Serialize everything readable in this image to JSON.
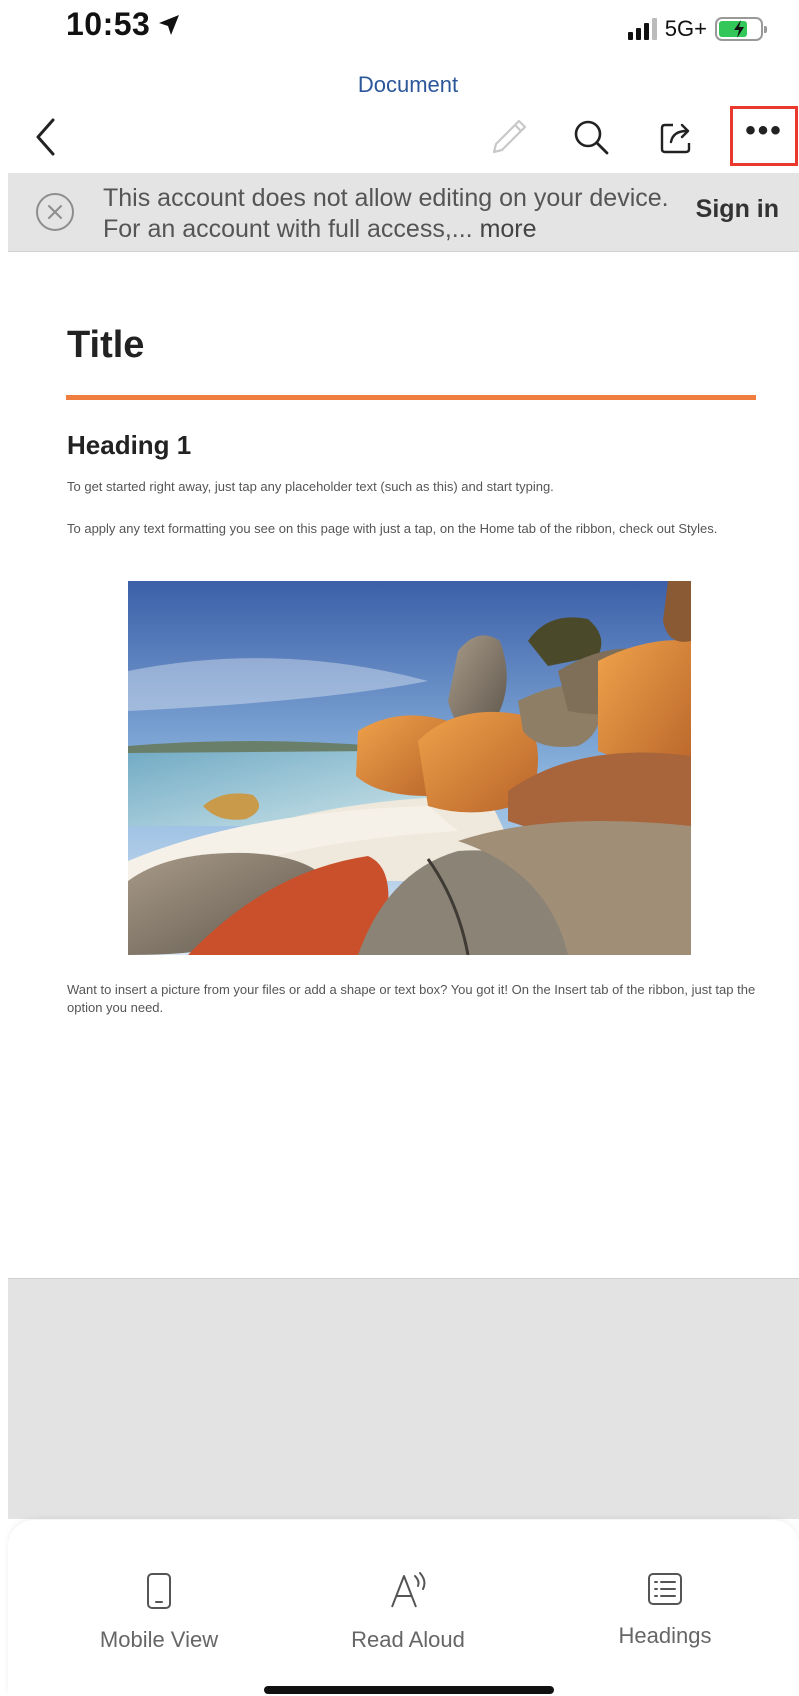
{
  "status_bar": {
    "time": "10:53",
    "network": "5G+"
  },
  "header": {
    "title": "Document",
    "icons": [
      "back-icon",
      "pencil-icon",
      "search-icon",
      "share-icon",
      "more-icon"
    ],
    "more_label": "•••"
  },
  "banner": {
    "message": "This account does not allow editing on your device. For an account with full access,...",
    "more": "more",
    "sign_in": "Sign in"
  },
  "document": {
    "title": "Title",
    "heading1": "Heading 1",
    "para1": "To get started right away, just tap any placeholder text (such as this) and start typing.",
    "para2": "To apply any text formatting you see on this page with just a tap, on the Home tab of the ribbon, check out Styles.",
    "para3": "Want to insert a picture from your files or add a shape or text box? You got it! On the Insert tab of the ribbon, just tap the option you need.",
    "accent_color": "#ef7e3e"
  },
  "bottom_sheet": {
    "items": [
      {
        "label": "Mobile View",
        "icon": "phone-icon"
      },
      {
        "label": "Read Aloud",
        "icon": "read-aloud-icon"
      },
      {
        "label": "Headings",
        "icon": "headings-icon"
      }
    ]
  },
  "colors": {
    "brand_blue": "#2b579a",
    "highlight_red": "#e8392c"
  }
}
